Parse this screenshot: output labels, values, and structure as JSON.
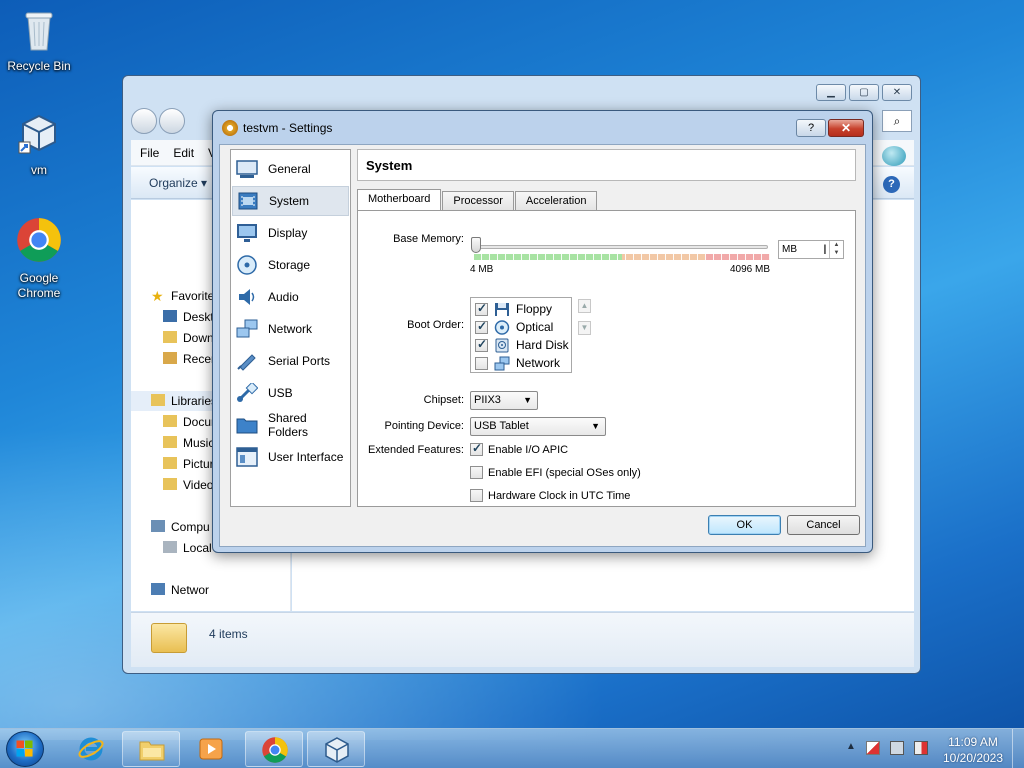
{
  "desktop": {
    "icons": [
      {
        "label": "Recycle Bin",
        "icon": "recycle-bin-icon"
      },
      {
        "label": "vm",
        "icon": "virtualbox-shortcut-icon"
      },
      {
        "label": "Google Chrome",
        "icon": "chrome-icon"
      }
    ]
  },
  "explorer": {
    "menu": {
      "file": "File",
      "edit": "Edit",
      "view": "V"
    },
    "toolbar": {
      "organize": "Organize ▾"
    },
    "nav": {
      "favorites": "Favorite",
      "desktop": "Deskto",
      "downloads": "Down",
      "recent": "Recen",
      "libraries": "Libraries",
      "documents": "Docur",
      "music": "Music",
      "pictures": "Pictur",
      "videos": "Video",
      "computer": "Compu",
      "local": "Local",
      "network": "Networ"
    },
    "status": "4 items"
  },
  "dialog": {
    "title": "testvm - Settings",
    "help_label": "?",
    "close_label": "✕",
    "categories": [
      {
        "label": "General",
        "icon": "general-icon"
      },
      {
        "label": "System",
        "icon": "system-icon"
      },
      {
        "label": "Display",
        "icon": "display-icon"
      },
      {
        "label": "Storage",
        "icon": "storage-icon"
      },
      {
        "label": "Audio",
        "icon": "audio-icon"
      },
      {
        "label": "Network",
        "icon": "network-icon"
      },
      {
        "label": "Serial Ports",
        "icon": "serial-ports-icon"
      },
      {
        "label": "USB",
        "icon": "usb-icon"
      },
      {
        "label": "Shared Folders",
        "icon": "shared-folders-icon"
      },
      {
        "label": "User Interface",
        "icon": "user-interface-icon"
      }
    ],
    "selected_category": "System",
    "section_title": "System",
    "tabs": [
      "Motherboard",
      "Processor",
      "Acceleration"
    ],
    "selected_tab": "Motherboard",
    "motherboard": {
      "base_memory_label": "Base Memory:",
      "slider_min": "4 MB",
      "slider_max": "4096 MB",
      "memory_value": "MB",
      "boot_order_label": "Boot Order:",
      "boot_items": [
        {
          "label": "Floppy",
          "checked": true,
          "icon": "floppy-icon"
        },
        {
          "label": "Optical",
          "checked": true,
          "icon": "optical-disc-icon"
        },
        {
          "label": "Hard Disk",
          "checked": true,
          "icon": "hard-disk-icon"
        },
        {
          "label": "Network",
          "checked": false,
          "icon": "network-boot-icon"
        }
      ],
      "chipset_label": "Chipset:",
      "chipset_value": "PIIX3",
      "pointing_label": "Pointing Device:",
      "pointing_value": "USB Tablet",
      "extended_label": "Extended Features:",
      "features": [
        {
          "label": "Enable I/O APIC",
          "checked": true
        },
        {
          "label": "Enable EFI (special OSes only)",
          "checked": false
        },
        {
          "label": "Hardware Clock in UTC Time",
          "checked": false
        }
      ]
    },
    "ok_label": "OK",
    "cancel_label": "Cancel"
  },
  "taskbar": {
    "time": "11:09 AM",
    "date": "10/20/2023"
  },
  "colors": {
    "accent": "#3c7fb1",
    "close_red": "#c7412c",
    "slider_green": "#a8e3a3",
    "slider_orange": "#f2c8a6",
    "slider_red": "#f1a9a9"
  }
}
